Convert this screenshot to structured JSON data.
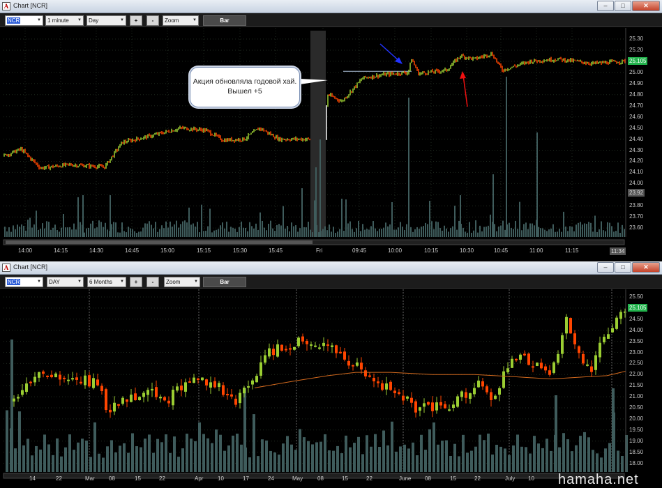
{
  "top_window": {
    "title": "Chart [NCR]",
    "toolbar": {
      "symbol": "NCR",
      "interval": "1 minute",
      "range": "Day",
      "zoom_in": "+",
      "zoom_out": "-",
      "zoom": "Zoom",
      "chart_type": "Bar"
    },
    "price_axis": [
      "25.30",
      "25.20",
      "25.10",
      "25.00",
      "24.90",
      "24.80",
      "24.70",
      "24.60",
      "24.50",
      "24.40",
      "24.30",
      "24.20",
      "24.10",
      "24.00",
      "23.90",
      "23.80",
      "23.70",
      "23.60"
    ],
    "last_price": "25.105",
    "marker_price": "23.92",
    "time_axis": [
      "14:00",
      "14:15",
      "14:30",
      "14:45",
      "15:00",
      "15:15",
      "15:30",
      "15:45",
      "Fri",
      "09:45",
      "10:00",
      "10:15",
      "10:30",
      "10:45",
      "11:00",
      "11:15"
    ],
    "time_marker": "11:34",
    "callout": "Акция обновляла годовой хай. Вышел +5"
  },
  "bottom_window": {
    "title": "Chart [NCR]",
    "toolbar": {
      "symbol": "NCR",
      "interval": "DAY",
      "range": "6 Months",
      "zoom_in": "+",
      "zoom_out": "-",
      "zoom": "Zoom",
      "chart_type": "Bar"
    },
    "price_axis": [
      "25.50",
      "25.00",
      "24.50",
      "24.00",
      "23.50",
      "23.00",
      "22.50",
      "22.00",
      "21.50",
      "21.00",
      "20.50",
      "20.00",
      "19.50",
      "19.00",
      "18.50",
      "18.00"
    ],
    "last_price": "25.105",
    "date_axis": [
      "14",
      "22",
      "Mar",
      "08",
      "15",
      "22",
      "Apr",
      "10",
      "17",
      "24",
      "May",
      "08",
      "15",
      "22",
      "June",
      "08",
      "15",
      "22",
      "July",
      "10"
    ]
  },
  "colors": {
    "up": "#9acd32",
    "down": "#ff4500",
    "volume": "#3f5c5c",
    "ma": "#d2691e",
    "badge": "#22b24c"
  },
  "watermark": "hamaha.net"
}
